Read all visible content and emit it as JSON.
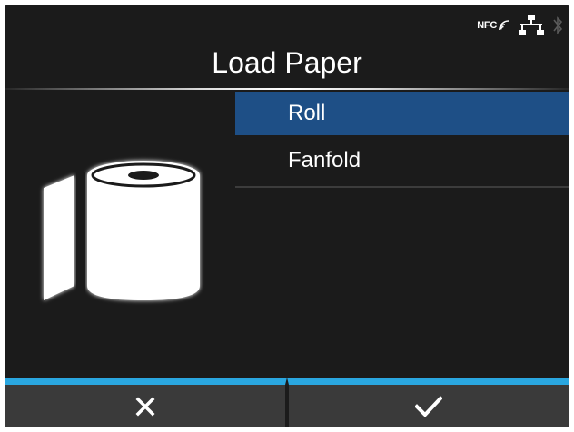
{
  "status_bar": {
    "nfc_label": "NFC",
    "icons": [
      "nfc-icon",
      "network-icon",
      "bluetooth-icon"
    ]
  },
  "screen": {
    "title": "Load Paper"
  },
  "menu": {
    "items": [
      {
        "label": "Roll",
        "selected": true
      },
      {
        "label": "Fanfold",
        "selected": false
      }
    ]
  },
  "illustration": {
    "icon": "paper-roll-icon"
  },
  "softkeys": {
    "left_icon": "close-icon",
    "right_icon": "checkmark-icon"
  },
  "colors": {
    "background": "#1b1b1b",
    "selection": "#1e4f86",
    "softkey_accent": "#2aa7e0",
    "softkey_bg": "#3a3a3a",
    "text": "#ffffff"
  }
}
